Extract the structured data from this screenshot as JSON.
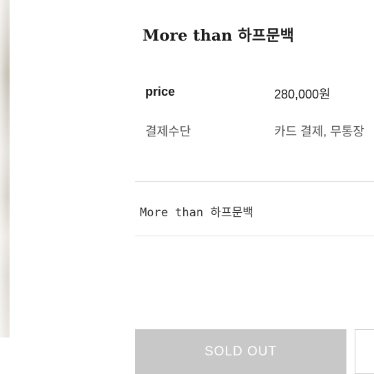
{
  "product": {
    "title": "More than 하프문백",
    "info": {
      "price_label": "price",
      "price_value": "280,000원",
      "payment_label": "결제수단",
      "payment_value": "카드 결제, 무통장"
    },
    "option_name": "More than 하프문백"
  },
  "actions": {
    "sold_out_label": "SOLD OUT"
  },
  "colors": {
    "sold_out_bg": "#c8c8c8",
    "divider": "#e2e2e2"
  }
}
